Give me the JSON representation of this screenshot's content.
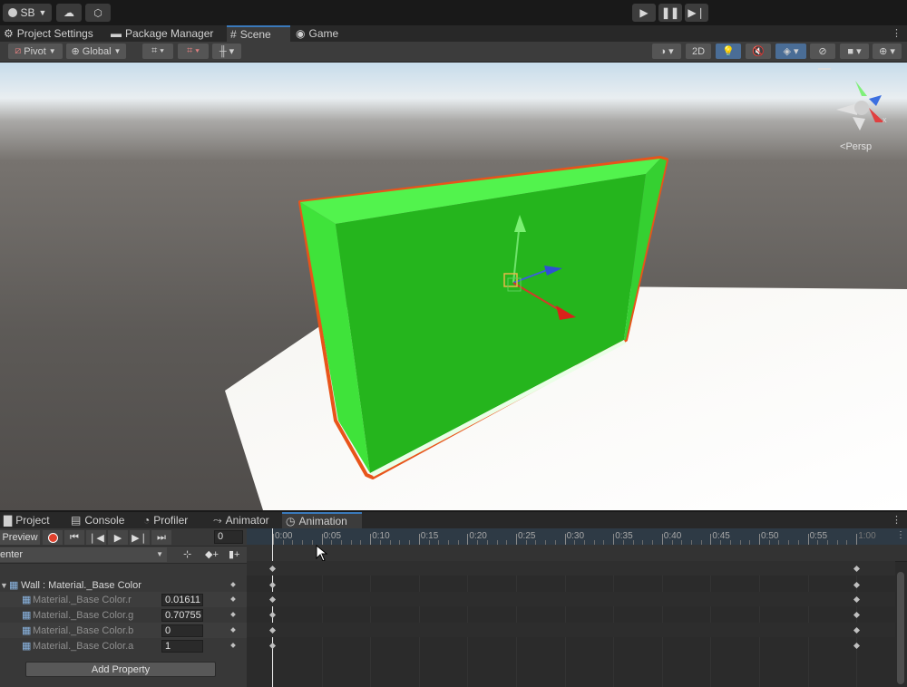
{
  "topbar": {
    "account_label": "SB",
    "account_icon": "account-icon",
    "cloud_icon": "cloud-icon",
    "collab_icon": "collab-icon",
    "play_icon": "play-icon",
    "pause_icon": "pause-icon",
    "step_icon": "step-icon"
  },
  "tabs": [
    {
      "label": "Project Settings",
      "icon": "gear-icon"
    },
    {
      "label": "Package Manager",
      "icon": "package-icon"
    },
    {
      "label": "Scene",
      "icon": "grid-icon",
      "active": true
    },
    {
      "label": "Game",
      "icon": "gamepad-icon"
    }
  ],
  "scene_toolbar": {
    "pivot_label": "Pivot",
    "global_label": "Global",
    "twod_label": "2D",
    "persp_label": "Persp"
  },
  "bottom_tabs": [
    {
      "label": "Project",
      "icon": "folder-icon"
    },
    {
      "label": "Console",
      "icon": "console-icon"
    },
    {
      "label": "Profiler",
      "icon": "profiler-icon"
    },
    {
      "label": "Animator",
      "icon": "animator-icon"
    },
    {
      "label": "Animation",
      "icon": "animation-icon",
      "active": true
    }
  ],
  "animation": {
    "preview_label": "Preview",
    "frame_value": "0",
    "clip_label": "enter",
    "object_label": "Wall : Material._Base Color",
    "properties": [
      {
        "name": "Material._Base Color.r",
        "value": "0.01611"
      },
      {
        "name": "Material._Base Color.g",
        "value": "0.70755"
      },
      {
        "name": "Material._Base Color.b",
        "value": "0"
      },
      {
        "name": "Material._Base Color.a",
        "value": "1"
      }
    ],
    "add_property_label": "Add Property",
    "timeline_ticks": [
      "0:00",
      "0:05",
      "0:10",
      "0:15",
      "0:20",
      "0:25",
      "0:30",
      "0:35",
      "0:40",
      "0:45",
      "0:50",
      "0:55",
      "1:00"
    ]
  },
  "colors": {
    "selection_outline": "#e8541a",
    "cube_front": "#24b51c",
    "cube_side": "#3ee23a",
    "cube_top": "#44ef40",
    "accent": "#3a79bb"
  }
}
